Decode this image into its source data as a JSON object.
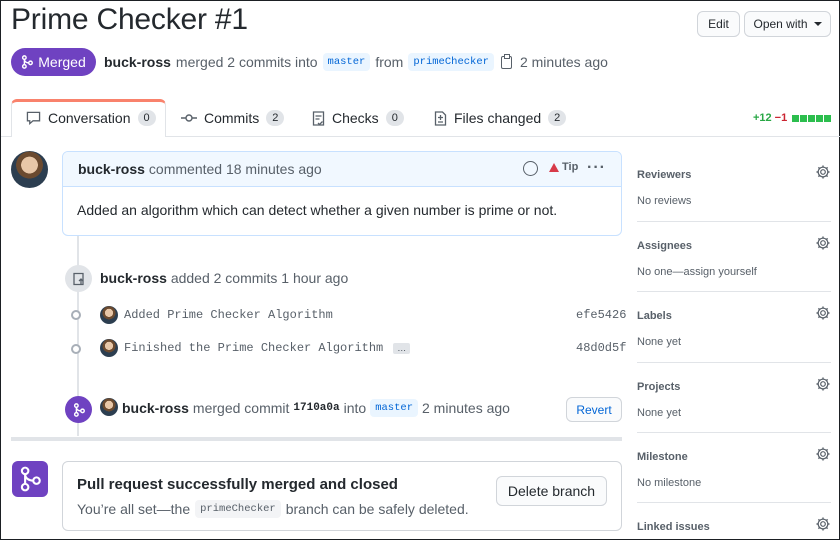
{
  "header": {
    "title": "Prime Checker #1",
    "edit_label": "Edit",
    "open_with_label": "Open with"
  },
  "status": {
    "badge": "Merged",
    "author": "buck-ross",
    "merged_text": "merged 2 commits into",
    "base_branch": "master",
    "from_text": "from",
    "head_branch": "primeChecker",
    "time": "2 minutes ago"
  },
  "tabs": [
    {
      "label": "Conversation",
      "count": "0",
      "icon": "comment-icon"
    },
    {
      "label": "Commits",
      "count": "2",
      "icon": "commit-icon"
    },
    {
      "label": "Checks",
      "count": "0",
      "icon": "checklist-icon"
    },
    {
      "label": "Files changed",
      "count": "2",
      "icon": "file-diff-icon"
    }
  ],
  "diffstat": {
    "additions": "+12",
    "deletions": "−1",
    "blocks": [
      "green",
      "green",
      "green",
      "green",
      "green"
    ]
  },
  "comment": {
    "author": "buck-ross",
    "meta": "commented 18 minutes ago",
    "tip_label": "Tip",
    "body": "Added an algorithm which can detect whether a given number is prime or not."
  },
  "commits_event": {
    "author": "buck-ross",
    "text": "added 2 commits 1 hour ago",
    "commits": [
      {
        "message": "Added Prime Checker Algorithm",
        "sha": "efe5426",
        "has_ellipsis": false
      },
      {
        "message": "Finished the Prime Checker Algorithm",
        "sha": "48d0d5f",
        "has_ellipsis": true
      }
    ],
    "ellipsis": "…"
  },
  "merge_event": {
    "author": "buck-ross",
    "text": "merged commit",
    "sha": "1710a0a",
    "into": "into",
    "branch": "master",
    "time": "2 minutes ago",
    "revert_label": "Revert"
  },
  "final": {
    "title": "Pull request successfully merged and closed",
    "sub_prefix": "You’re all set—the",
    "branch": "primeChecker",
    "sub_suffix": "branch can be safely deleted.",
    "delete_label": "Delete branch"
  },
  "sidebar": [
    {
      "title": "Reviewers",
      "value": "No reviews"
    },
    {
      "title": "Assignees",
      "value": "No one—assign yourself"
    },
    {
      "title": "Labels",
      "value": "None yet"
    },
    {
      "title": "Projects",
      "value": "None yet"
    },
    {
      "title": "Milestone",
      "value": "No milestone"
    },
    {
      "title": "Linked issues",
      "value": ""
    }
  ],
  "colors": {
    "accent_merged": "#6f42c1",
    "link": "#0366d6",
    "active_tab": "#f9826c",
    "addition": "#28a745",
    "deletion": "#cb2431"
  }
}
